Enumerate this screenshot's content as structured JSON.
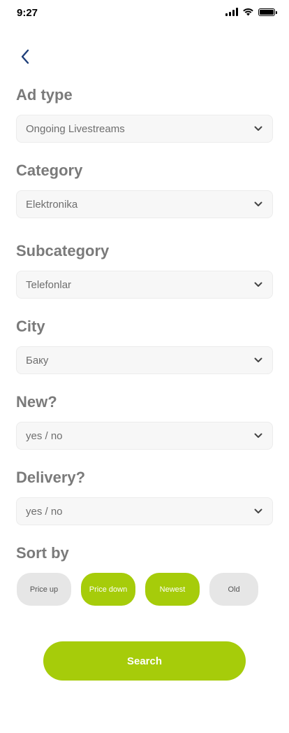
{
  "status_bar": {
    "time": "9:27"
  },
  "fields": {
    "ad_type": {
      "label": "Ad type",
      "value": "Ongoing Livestreams"
    },
    "category": {
      "label": "Category",
      "value": "Elektronika"
    },
    "subcategory": {
      "label": "Subcategory",
      "value": "Telefonlar"
    },
    "city": {
      "label": "City",
      "value": "Баку"
    },
    "new": {
      "label": "New?",
      "value": "yes / no"
    },
    "delivery": {
      "label": "Delivery?",
      "value": "yes / no"
    }
  },
  "sort": {
    "label": "Sort by",
    "options": [
      {
        "label": "Price up",
        "selected": false
      },
      {
        "label": "Price down",
        "selected": true
      },
      {
        "label": "Newest",
        "selected": true
      },
      {
        "label": "Old",
        "selected": false
      }
    ]
  },
  "search_button": {
    "label": "Search"
  },
  "colors": {
    "accent": "#a6cc0a",
    "back_arrow": "#1f3f7a",
    "label_gray": "#7a7a7a"
  },
  "icons": {
    "back": "chevron-left-icon",
    "dropdown": "chevron-down-icon"
  }
}
